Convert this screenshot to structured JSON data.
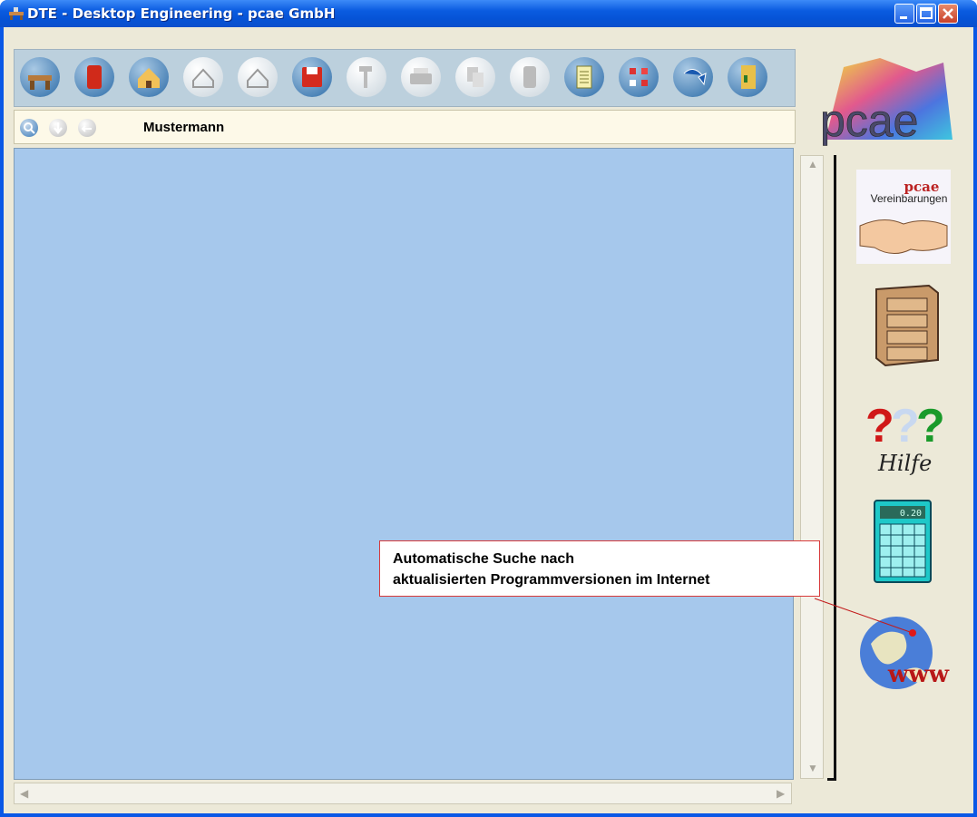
{
  "window": {
    "title": "DTE - Desktop Engineering - pcae GmbH"
  },
  "toolbar": {
    "icons": [
      "desk-icon",
      "binder-icon",
      "house-icon",
      "house-outline-icon",
      "house-outline-2-icon",
      "floppy-disk-icon",
      "hammer-icon",
      "printer-icon",
      "copy-icon",
      "cylinder-icon",
      "notepad-icon",
      "network-icon",
      "undo-arrow-icon",
      "exit-door-icon"
    ]
  },
  "search_bar": {
    "label": "Mustermann"
  },
  "sidebar": {
    "logo": "pcae",
    "agreements": {
      "brand": "pcae",
      "label": "Vereinbarungen"
    },
    "help": {
      "label": "Hilfe"
    },
    "calculator_display": "0.20",
    "www": {
      "label": "www"
    }
  },
  "tooltip": {
    "line1": "Automatische Suche nach",
    "line2": "aktualisierten Programmversionen im Internet"
  },
  "colors": {
    "main_bg": "#a6c8ec",
    "tooltip_border": "#d83a3a"
  }
}
